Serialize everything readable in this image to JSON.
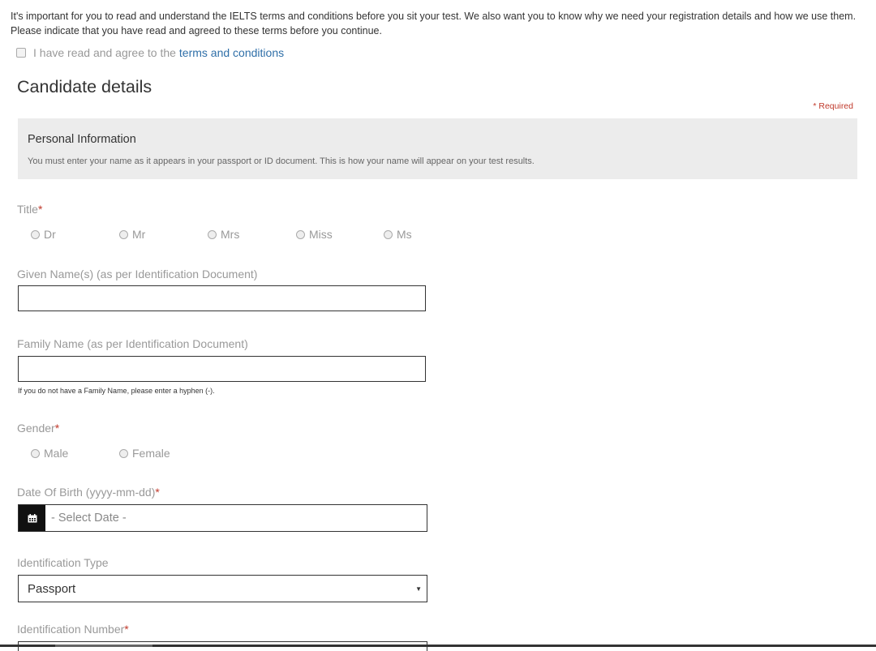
{
  "intro": {
    "text": "It's important for you to read and understand the IELTS terms and conditions before you sit your test. We also want you to know why we need your registration details and how we use them. Please indicate that you have read and agreed to these terms before you continue."
  },
  "terms": {
    "label": "I have read and agree to the",
    "link": "terms and conditions"
  },
  "page_title": "Candidate details",
  "required_note": "* Required",
  "personal_info": {
    "heading": "Personal Information",
    "text": "You must enter your name as it appears in your passport or ID document. This is how your name will appear on your test results."
  },
  "title_field": {
    "label": "Title",
    "required_mark": "*",
    "options": [
      "Dr",
      "Mr",
      "Mrs",
      "Miss",
      "Ms"
    ]
  },
  "given_name": {
    "label": "Given Name(s) (as per Identification Document)",
    "value": ""
  },
  "family_name": {
    "label": "Family Name (as per Identification Document)",
    "value": "",
    "help": "If you do not have a Family Name, please enter a hyphen (-)."
  },
  "gender": {
    "label": "Gender",
    "required_mark": "*",
    "options": [
      "Male",
      "Female"
    ]
  },
  "dob": {
    "label": "Date Of Birth (yyyy-mm-dd)",
    "required_mark": "*",
    "placeholder": "- Select Date -",
    "icon": "calendar-icon"
  },
  "id_type": {
    "label": "Identification Type",
    "selected": "Passport"
  },
  "id_number": {
    "label": "Identification Number",
    "required_mark": "*"
  },
  "colors": {
    "link": "#2f6fa8",
    "required": "#c0392b",
    "info_bg": "#ececec"
  }
}
